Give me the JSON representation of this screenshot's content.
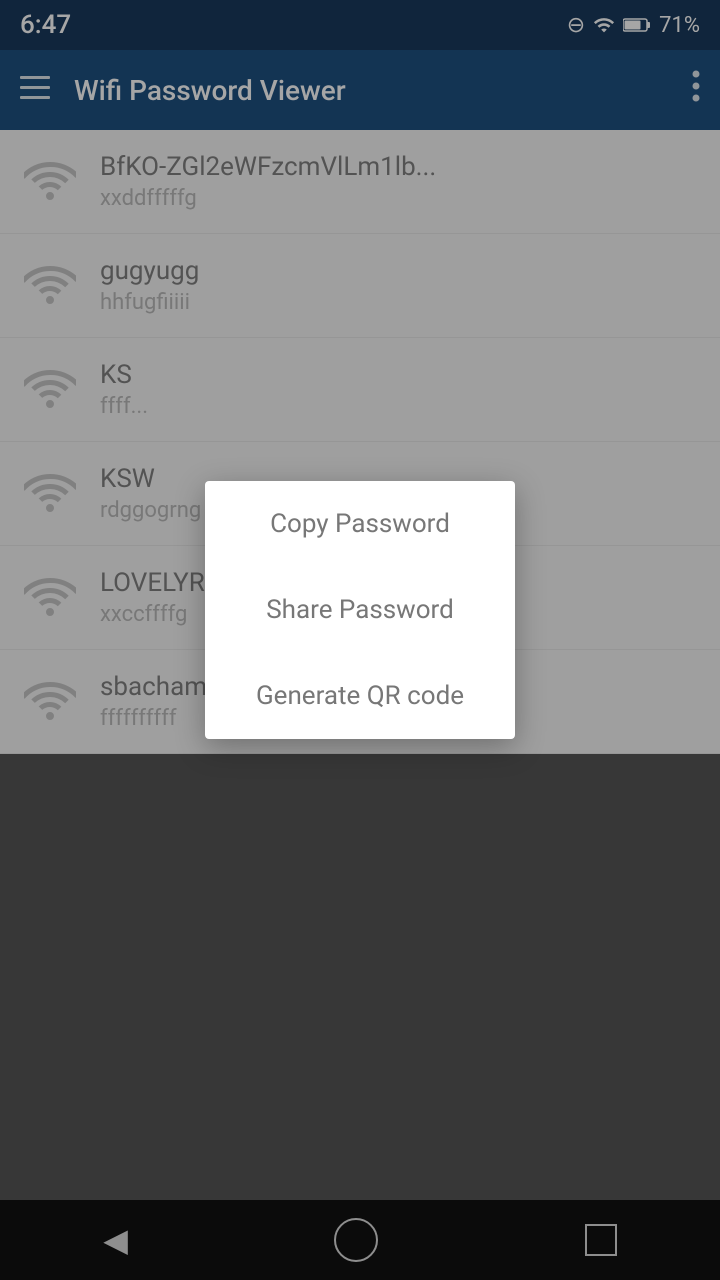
{
  "statusBar": {
    "time": "6:47",
    "battery": "71%"
  },
  "appBar": {
    "title": "Wifi Password Viewer"
  },
  "wifiItems": [
    {
      "name": "BfKO-ZGl2eWFzcmVlLm1lb...",
      "password": "xxddfffffg"
    },
    {
      "name": "gugyugg",
      "password": "hhfugfiiiii"
    },
    {
      "name": "KS",
      "password": "ffff..."
    },
    {
      "name": "KSW",
      "password": "rdggogrng"
    },
    {
      "name": "LOVELYRUTHWIK",
      "password": "xxccffffg"
    },
    {
      "name": "sbacham",
      "password": "ffffffffff"
    }
  ],
  "dialog": {
    "items": [
      {
        "label": "Copy Password",
        "id": "copy-password"
      },
      {
        "label": "Share Password",
        "id": "share-password"
      },
      {
        "label": "Generate QR code",
        "id": "generate-qr"
      }
    ]
  },
  "navBar": {
    "back": "◀",
    "home": "○",
    "recent": "□"
  }
}
